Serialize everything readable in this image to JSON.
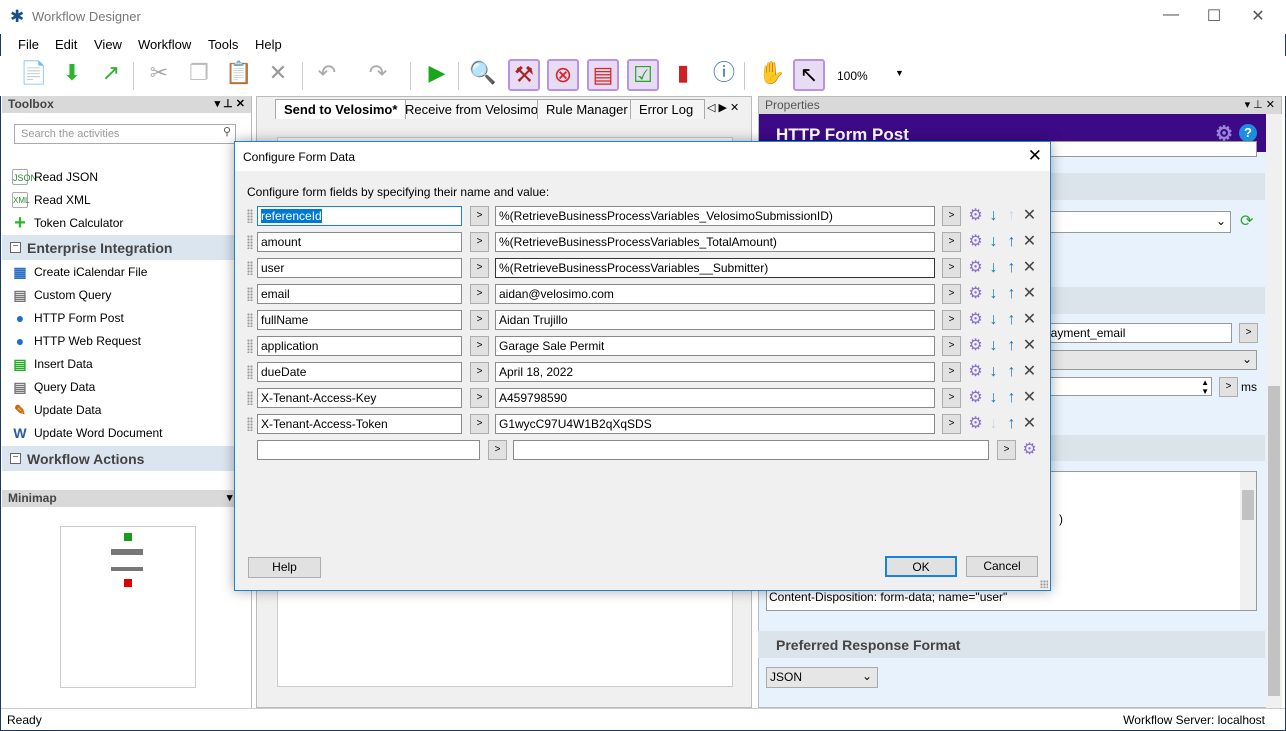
{
  "app": {
    "title": "Workflow Designer",
    "icon": "gear-icon"
  },
  "menu": [
    "File",
    "Edit",
    "View",
    "Workflow",
    "Tools",
    "Help"
  ],
  "toolbar": {
    "zoom": "100%",
    "icons": [
      "new-workflow-icon",
      "open-workflow-icon",
      "publish-workflow-icon",
      "cut-icon",
      "copy-icon",
      "paste-icon",
      "delete-icon",
      "undo-icon",
      "redo-icon",
      "run-icon",
      "find-icon",
      "tools-icon",
      "error-icon",
      "rule-icon",
      "checklist-icon",
      "chart-icon",
      "info-icon",
      "pan-hand-icon",
      "pointer-icon"
    ]
  },
  "toolbox": {
    "title": "Toolbox",
    "search_placeholder": "Search the activities",
    "items_top": [
      {
        "label": "Read JSON",
        "icon": "JSON"
      },
      {
        "label": "Read XML",
        "icon": "XML"
      },
      {
        "label": "Token Calculator",
        "icon": "+"
      }
    ],
    "category1": "Enterprise Integration",
    "items": [
      {
        "label": "Create iCalendar File"
      },
      {
        "label": "Custom Query"
      },
      {
        "label": "HTTP Form Post"
      },
      {
        "label": "HTTP Web Request"
      },
      {
        "label": "Insert Data"
      },
      {
        "label": "Query Data"
      },
      {
        "label": "Update Data"
      },
      {
        "label": "Update Word Document"
      }
    ],
    "category2": "Workflow Actions"
  },
  "minimap": {
    "title": "Minimap"
  },
  "tabs": [
    "Send to Velosimo*",
    "Receive from Velosimo",
    "Rule Manager",
    "Error Log"
  ],
  "properties": {
    "title": "Properties",
    "header": "HTTP Form Post",
    "field_value": "payment_email",
    "unit": "ms",
    "body_line1": ")",
    "body_line2": "Content-Disposition: form-data; name=\"user\"",
    "section_response": "Preferred Response Format",
    "response_format": "JSON",
    "accent": "#3d0a87"
  },
  "dialog": {
    "title": "Configure Form Data",
    "instructions": "Configure form fields by specifying their name and value:",
    "rows": [
      {
        "name": "referenceId",
        "value": "%(RetrieveBusinessProcessVariables_VelosimoSubmissionID)"
      },
      {
        "name": "amount",
        "value": "%(RetrieveBusinessProcessVariables_TotalAmount)"
      },
      {
        "name": "user",
        "value": "%(RetrieveBusinessProcessVariables__Submitter)"
      },
      {
        "name": "email",
        "value": "aidan@velosimo.com"
      },
      {
        "name": "fullName",
        "value": "Aidan Trujillo"
      },
      {
        "name": "application",
        "value": "Garage Sale Permit"
      },
      {
        "name": "dueDate",
        "value": "April 18, 2022"
      },
      {
        "name": "X-Tenant-Access-Key",
        "value": "A459798590"
      },
      {
        "name": "X-Tenant-Access-Token",
        "value": "G1wycC97U4W1B2qXqSDS"
      }
    ],
    "help": "Help",
    "ok": "OK",
    "cancel": "Cancel"
  },
  "status": {
    "left": "Ready",
    "right": "Workflow Server: localhost"
  }
}
